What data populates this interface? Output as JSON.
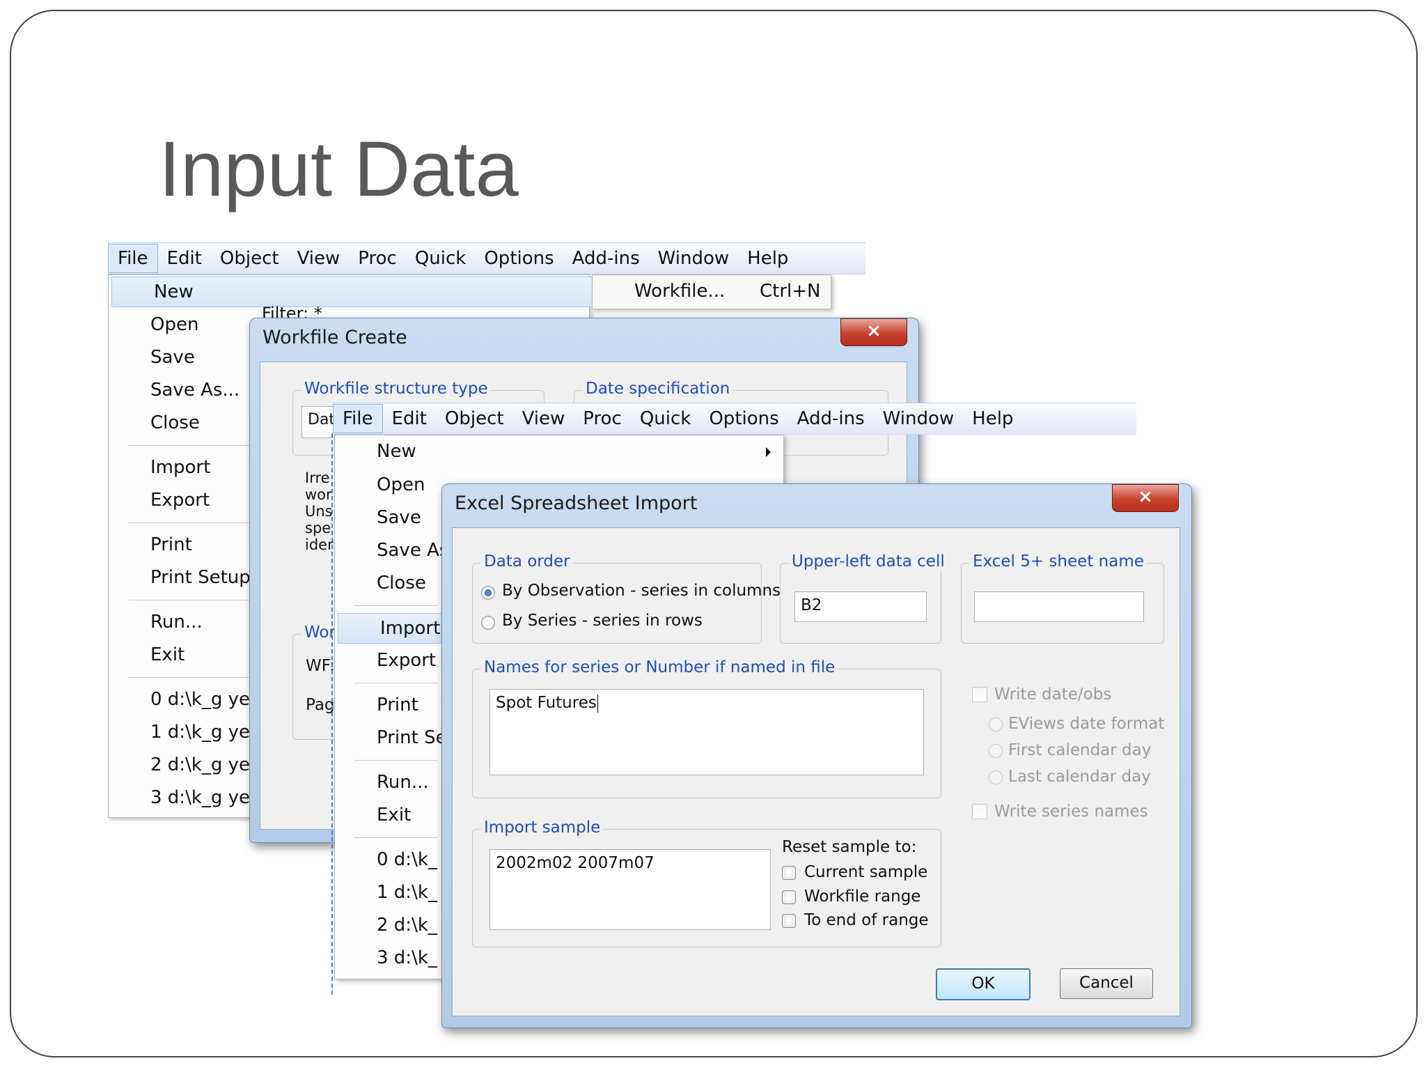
{
  "slide": {
    "title": "Input Data"
  },
  "menubar": [
    "File",
    "Edit",
    "Object",
    "View",
    "Proc",
    "Quick",
    "Options",
    "Add-ins",
    "Window",
    "Help"
  ],
  "file_menu": {
    "items": [
      "New",
      "Open",
      "Save",
      "Save As...",
      "Close",
      "Import",
      "Export",
      "Print",
      "Print Setup...",
      "Run...",
      "Exit",
      "0 d:\\k_g yer",
      "1 d:\\k_g yer",
      "2 d:\\k_g yer",
      "3 d:\\k_g yer"
    ]
  },
  "file_menu_front": {
    "items": [
      "New",
      "Open",
      "Save",
      "Save As",
      "Close",
      "Import",
      "Export",
      "Print",
      "Print Se",
      "Run...",
      "Exit",
      "0 d:\\k_",
      "1 d:\\k_",
      "2 d:\\k_",
      "3 d:\\k_"
    ]
  },
  "new_submenu": {
    "label": "Workfile...",
    "shortcut": "Ctrl+N"
  },
  "filter_label": "Filter: *",
  "workfile_create": {
    "title": "Workfile Create",
    "close_glyph": "×",
    "structure_group": "Workfile structure type",
    "date_group": "Date specification",
    "structure_value": "Dat",
    "desc_lines": [
      "Irre",
      "wor",
      "Uns",
      "spe",
      "ider"
    ],
    "wor_group": "Wor",
    "wf_label": "WF:",
    "pag_label": "Pag"
  },
  "excel_import": {
    "title": "Excel Spreadsheet Import",
    "close_glyph": "×",
    "data_order": {
      "label": "Data order",
      "options": [
        "By Observation - series in columns",
        "By Series - series in rows"
      ]
    },
    "upper_left": {
      "label": "Upper-left data cell",
      "value": "B2"
    },
    "sheet_name": {
      "label": "Excel 5+ sheet name",
      "value": ""
    },
    "names": {
      "label": "Names for series or Number if named in file",
      "value": "Spot Futures"
    },
    "write_date_obs": "Write date/obs",
    "date_formats": [
      "EViews date format",
      "First calendar day",
      "Last calendar day"
    ],
    "write_series_names": "Write series names",
    "import_sample": {
      "label": "Import sample",
      "value": "2002m02 2007m07"
    },
    "reset": {
      "label": "Reset sample to:",
      "options": [
        "Current sample",
        "Workfile range",
        "To end of range"
      ]
    },
    "ok": "OK",
    "cancel": "Cancel"
  }
}
